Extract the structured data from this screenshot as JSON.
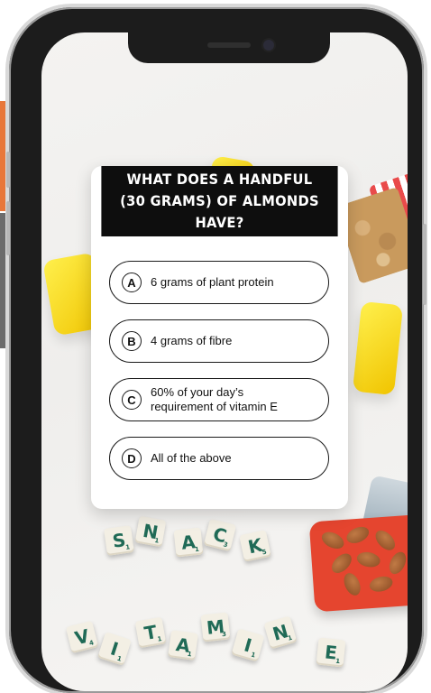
{
  "quiz": {
    "question": "WHAT DOES A HANDFUL\n(30 GRAMS) OF ALMONDS HAVE?",
    "options": [
      {
        "letter": "A",
        "text": "6 grams of plant protein"
      },
      {
        "letter": "B",
        "text": "4 grams of fibre"
      },
      {
        "letter": "C",
        "text": "60% of your day’s\nrequirement of vitamin E"
      },
      {
        "letter": "D",
        "text": "All of the above"
      }
    ]
  },
  "tiles_snack": [
    {
      "letter": "S",
      "score": "1"
    },
    {
      "letter": "N",
      "score": "1"
    },
    {
      "letter": "A",
      "score": "1"
    },
    {
      "letter": "C",
      "score": "3"
    },
    {
      "letter": "K",
      "score": "5"
    }
  ],
  "tiles_vitamine": [
    {
      "letter": "V",
      "score": "4"
    },
    {
      "letter": "I",
      "score": "1"
    },
    {
      "letter": "T",
      "score": "1"
    },
    {
      "letter": "A",
      "score": "1"
    },
    {
      "letter": "M",
      "score": "3"
    },
    {
      "letter": "I",
      "score": "1"
    },
    {
      "letter": "N",
      "score": "1"
    },
    {
      "letter": "E",
      "score": "1"
    }
  ],
  "colors": {
    "header_bg": "#0e0e0e",
    "tile_text": "#1f6a56",
    "accent_orange": "#e8773a"
  }
}
